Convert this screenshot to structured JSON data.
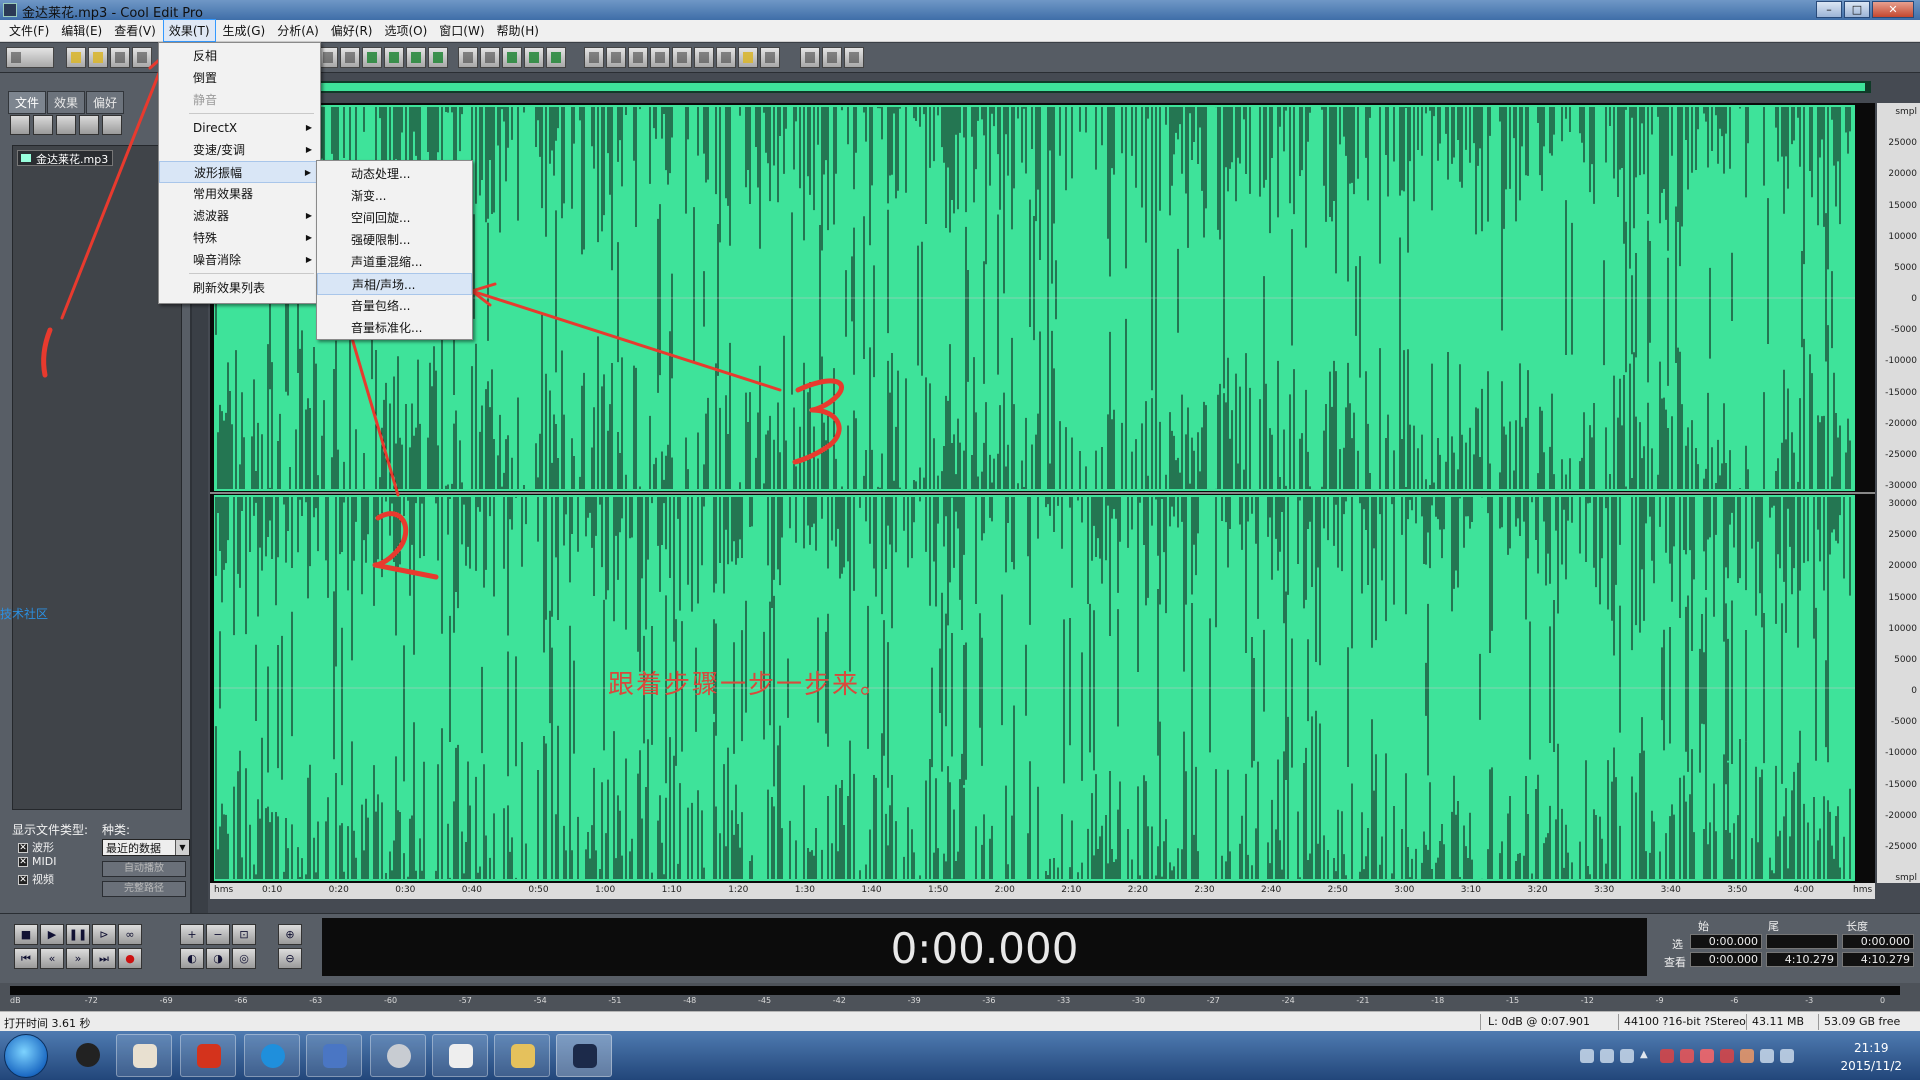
{
  "window": {
    "title": "金达莱花.mp3 - Cool Edit Pro",
    "controls": [
      "–",
      "□",
      "✕"
    ]
  },
  "menubar": {
    "items": [
      "文件(F)",
      "编辑(E)",
      "查看(V)",
      "效果(T)",
      "生成(G)",
      "分析(A)",
      "偏好(R)",
      "选项(O)",
      "窗口(W)",
      "帮助(H)"
    ],
    "active_index": 3
  },
  "effects_menu": {
    "items": [
      {
        "label": "反相",
        "enabled": true,
        "submenu": false
      },
      {
        "label": "倒置",
        "enabled": true,
        "submenu": false
      },
      {
        "label": "静音",
        "enabled": false,
        "submenu": false
      },
      {
        "label": "DirectX",
        "enabled": true,
        "submenu": true
      },
      {
        "label": "变速/变调",
        "enabled": true,
        "submenu": true
      },
      {
        "label": "波形振幅",
        "enabled": true,
        "submenu": true,
        "highlighted": true
      },
      {
        "label": "常用效果器",
        "enabled": true,
        "submenu": false
      },
      {
        "label": "滤波器",
        "enabled": true,
        "submenu": true
      },
      {
        "label": "特殊",
        "enabled": true,
        "submenu": true
      },
      {
        "label": "噪音消除",
        "enabled": true,
        "submenu": true
      },
      {
        "label": "刷新效果列表",
        "enabled": true,
        "submenu": false
      }
    ]
  },
  "amplitude_submenu": {
    "items": [
      {
        "label": "动态处理..."
      },
      {
        "label": "渐变..."
      },
      {
        "label": "空间回旋..."
      },
      {
        "label": "强硬限制..."
      },
      {
        "label": "声道重混缩..."
      },
      {
        "label": "声相/声场...",
        "highlighted": true
      },
      {
        "label": "音量包络..."
      },
      {
        "label": "音量标准化..."
      }
    ]
  },
  "left_panel": {
    "tabs": [
      "文件",
      "效果",
      "偏好"
    ],
    "active_tab": 0,
    "files": [
      "金达莱花.mp3"
    ],
    "show_types_label": "显示文件类型:",
    "sort_label": "种类:",
    "types": [
      {
        "label": "波形",
        "checked": true
      },
      {
        "label": "MIDI",
        "checked": true
      },
      {
        "label": "视频",
        "checked": true
      }
    ],
    "sort_value": "最近的数据",
    "buttons": [
      "自动播放",
      "完整路径"
    ],
    "side_text": "技术社区"
  },
  "waveform": {
    "colors": {
      "wave": "#3ee39a",
      "background": "#0a0a0a"
    },
    "amplitude_labels_top": [
      "smpl",
      "25000",
      "20000",
      "15000",
      "10000",
      "5000",
      "0",
      "-5000",
      "-10000",
      "-15000",
      "-20000",
      "-25000",
      "-30000"
    ],
    "amplitude_labels_bottom": [
      "30000",
      "25000",
      "20000",
      "15000",
      "10000",
      "5000",
      "0",
      "-5000",
      "-10000",
      "-15000",
      "-20000",
      "-25000",
      "smpl"
    ],
    "time_labels": [
      "hms",
      "0:10",
      "0:20",
      "0:30",
      "0:40",
      "0:50",
      "1:00",
      "1:10",
      "1:20",
      "1:30",
      "1:40",
      "1:50",
      "2:00",
      "2:10",
      "2:20",
      "2:30",
      "2:40",
      "2:50",
      "3:00",
      "3:10",
      "3:20",
      "3:30",
      "3:40",
      "3:50",
      "4:00",
      "hms"
    ]
  },
  "annotation": {
    "text": "跟着步骤一步一步来。",
    "numbers": [
      "1",
      "2",
      "3"
    ],
    "color": "#d84a3c"
  },
  "transport": {
    "time": "0:00.000",
    "sel_headers": [
      "始",
      "尾",
      "长度"
    ],
    "row_labels": [
      "选",
      "查看"
    ],
    "selection": [
      "0:00.000",
      "",
      "0:00.000"
    ],
    "view": [
      "0:00.000",
      "4:10.279",
      "4:10.279"
    ]
  },
  "level_meter": {
    "ticks": [
      "dB",
      "-72",
      "-69",
      "-66",
      "-63",
      "-60",
      "-57",
      "-54",
      "-51",
      "-48",
      "-45",
      "-42",
      "-39",
      "-36",
      "-33",
      "-30",
      "-27",
      "-24",
      "-21",
      "-18",
      "-15",
      "-12",
      "-9",
      "-6",
      "-3",
      "0"
    ]
  },
  "statusbar": {
    "open_time": "打开时间  3.61 秒",
    "level": "L: 0dB @  0:07.901",
    "format": "44100 ?16-bit ?Stereo",
    "size": "43.11 MB",
    "free": "53.09 GB free"
  },
  "taskbar": {
    "apps": [
      "qq-icon",
      "app-icon",
      "game-icon",
      "kugou-icon",
      "network-icon",
      "camera-icon",
      "usb-icon",
      "folder-icon",
      "cooledit-icon"
    ],
    "time": "21:19",
    "date": "2015/11/2"
  }
}
